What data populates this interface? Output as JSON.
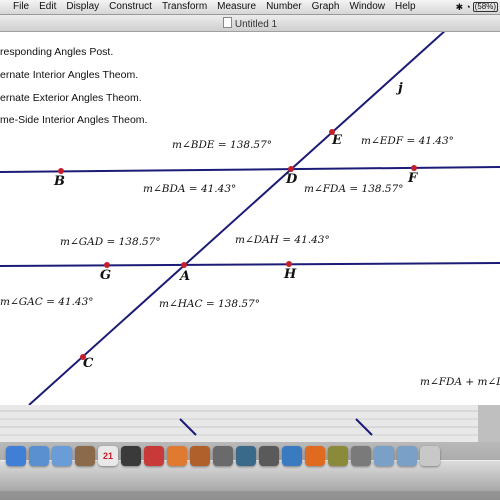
{
  "menubar": {
    "apple": "",
    "items": [
      "File",
      "Edit",
      "Display",
      "Construct",
      "Transform",
      "Measure",
      "Number",
      "Graph",
      "Window",
      "Help"
    ],
    "battery": "(58%)"
  },
  "window": {
    "title": "Untitled 1"
  },
  "justifications": [
    "responding Angles Post.",
    "ernate Interior Angles Theom.",
    "ernate Exterior Angles Theom.",
    "me-Side Interior Angles Theom."
  ],
  "points": {
    "A": "A",
    "B": "B",
    "C": "C",
    "D": "D",
    "E": "E",
    "F": "F",
    "G": "G",
    "H": "H",
    "j": "j"
  },
  "measurements": {
    "bde": "m∠BDE = 138.57°",
    "edf": "m∠EDF = 41.43°",
    "bda": "m∠BDA = 41.43°",
    "fda": "m∠FDA = 138.57°",
    "gad": "m∠GAD = 138.57°",
    "dah": "m∠DAH = 41.43°",
    "gac": "m∠GAC = 41.43°",
    "hac": "m∠HAC = 138.57°",
    "sum": "m∠FDA + m∠D"
  },
  "colors": {
    "line": "#1c1c78",
    "point": "#c41e2a"
  },
  "dock": {
    "icons": [
      {
        "name": "finder-icon",
        "color": "#3f7fd6",
        "label": ""
      },
      {
        "name": "globe-icon",
        "color": "#5a8fd0",
        "label": ""
      },
      {
        "name": "mail-icon",
        "color": "#6a9cd8",
        "label": ""
      },
      {
        "name": "photo-icon",
        "color": "#8a6a4a",
        "label": ""
      },
      {
        "name": "calendar-icon",
        "color": "#e8e8e8",
        "label": "21"
      },
      {
        "name": "app-icon",
        "color": "#3a3a3a",
        "label": ""
      },
      {
        "name": "itunes-icon",
        "color": "#c83a3a",
        "label": ""
      },
      {
        "name": "music-icon",
        "color": "#e07a30",
        "label": ""
      },
      {
        "name": "guitar-icon",
        "color": "#b0602a",
        "label": ""
      },
      {
        "name": "app-icon",
        "color": "#6a6a6a",
        "label": ""
      },
      {
        "name": "time-machine-icon",
        "color": "#3a6a8a",
        "label": ""
      },
      {
        "name": "app-icon",
        "color": "#5a5a5a",
        "label": ""
      },
      {
        "name": "browser-icon",
        "color": "#3a7ac0",
        "label": ""
      },
      {
        "name": "firefox-icon",
        "color": "#e06a20",
        "label": ""
      },
      {
        "name": "app-icon",
        "color": "#8a8a3a",
        "label": ""
      },
      {
        "name": "app-icon",
        "color": "#7a7a7a",
        "label": ""
      },
      {
        "name": "folder-icon",
        "color": "#7aa0c8",
        "label": ""
      },
      {
        "name": "folder-icon",
        "color": "#7aa0c8",
        "label": ""
      },
      {
        "name": "trash-icon",
        "color": "#c8c8c8",
        "label": ""
      }
    ]
  }
}
